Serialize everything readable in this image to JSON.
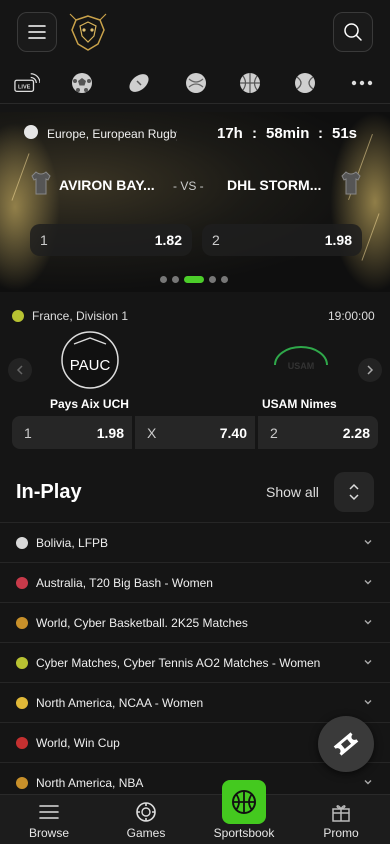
{
  "hero": {
    "league": "Europe, European Rugby Cha",
    "timer": {
      "hours": "17h",
      "sep1": ":",
      "minutes": "58min",
      "sep2": ":",
      "seconds": "51s"
    },
    "home_team": "AVIRON BAY...",
    "vs": "- VS -",
    "away_team": "DHL STORM...",
    "odds": [
      {
        "label": "1",
        "value": "1.82"
      },
      {
        "label": "2",
        "value": "1.98"
      }
    ],
    "carousel_dots": 5,
    "carousel_active": 2
  },
  "match2": {
    "league": "France, Division 1",
    "time": "19:00:00",
    "home_team": "Pays Aix UCH",
    "away_team": "USAM Nimes",
    "home_logo_text": "PAUC",
    "away_logo_text": "USAM",
    "odds": [
      {
        "label": "1",
        "value": "1.98"
      },
      {
        "label": "X",
        "value": "7.40"
      },
      {
        "label": "2",
        "value": "2.28"
      }
    ]
  },
  "inplay": {
    "title": "In-Play",
    "show_all": "Show all",
    "rows": [
      {
        "label": "Bolivia, LFPB",
        "icon": "soccer-icon",
        "color": "#d9d9d9"
      },
      {
        "label": "Australia, T20 Big Bash - Women",
        "icon": "cricket-icon",
        "color": "#c83a4a"
      },
      {
        "label": "World, Cyber Basketball. 2K25 Matches",
        "icon": "basketball-icon",
        "color": "#c8902a"
      },
      {
        "label": "Cyber Matches, Cyber Tennis AO2 Matches - Women",
        "icon": "tennis-icon",
        "color": "#b8c232"
      },
      {
        "label": "North America, NCAA - Women",
        "icon": "volleyball-icon",
        "color": "#e0b838"
      },
      {
        "label": "World, Win Cup",
        "icon": "hockey-icon",
        "color": "#c43030"
      },
      {
        "label": "North America, NBA",
        "icon": "basketball-icon",
        "color": "#c8902a"
      }
    ]
  },
  "nav": {
    "browse": "Browse",
    "games": "Games",
    "sportsbook": "Sportsbook",
    "promo": "Promo"
  },
  "colors": {
    "accent": "#44c91f",
    "background": "#151515"
  }
}
